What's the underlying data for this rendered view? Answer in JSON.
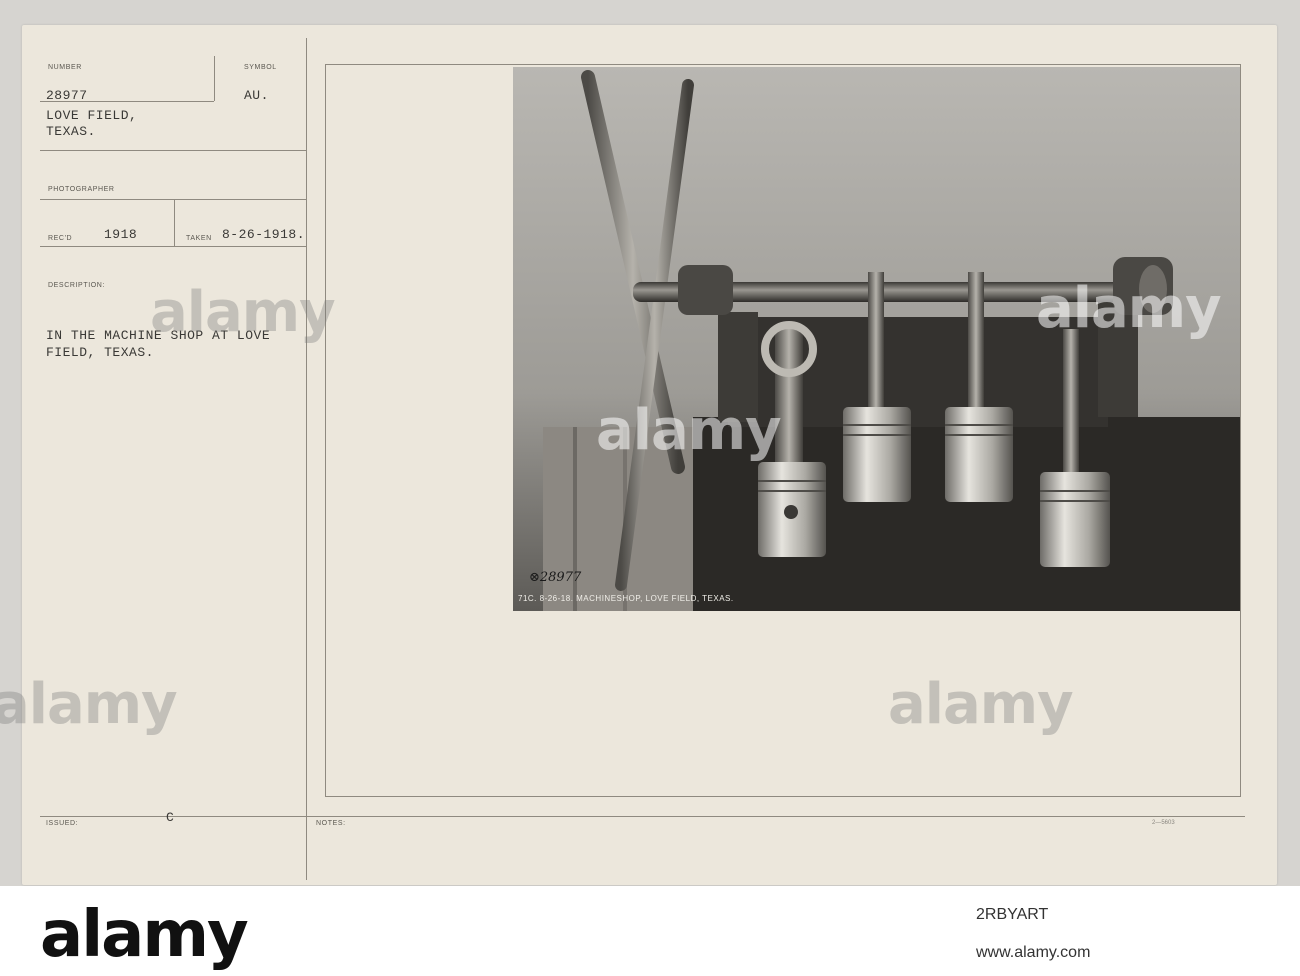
{
  "record_card": {
    "number_label": "NUMBER",
    "number": "28977",
    "symbol_label": "SYMBOL",
    "symbol": "AU.",
    "location_line1": "LOVE FIELD,",
    "location_line2": "TEXAS.",
    "photographer_label": "PHOTOGRAPHER",
    "recd_label": "REC'D",
    "recd_year": "1918",
    "taken_label": "TAKEN",
    "taken_date": "8-26-1918.",
    "description_label": "DESCRIPTION:",
    "description_line1": "IN THE MACHINE SHOP AT LOVE",
    "description_line2": "FIELD, TEXAS.",
    "issued_label": "ISSUED:",
    "issued_mark": "C",
    "notes_label": "NOTES:",
    "form_number": "2—5603"
  },
  "photo": {
    "negative_number": "⊗28977",
    "caption": "71C. 8-26-18. MACHINESHOP, LOVE FIELD, TEXAS."
  },
  "watermark": {
    "text": "alamy",
    "image_id": "2RBYART",
    "url": "www.alamy.com"
  },
  "colors": {
    "card": "#ece7dc",
    "ink": "#3a3936",
    "rule": "#8f8a80"
  }
}
